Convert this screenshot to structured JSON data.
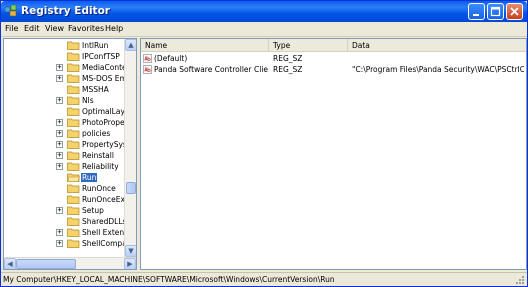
{
  "window": {
    "title": "Registry Editor"
  },
  "menu": [
    "File",
    "Edit",
    "View",
    "Favorites",
    "Help"
  ],
  "tree": {
    "items": [
      {
        "label": "IntlRun",
        "expandable": false,
        "selected": false
      },
      {
        "label": "IPConfTSP",
        "expandable": false,
        "selected": false
      },
      {
        "label": "MediaContentI",
        "expandable": true,
        "selected": false
      },
      {
        "label": "MS-DOS Emul",
        "expandable": true,
        "selected": false
      },
      {
        "label": "MSSHA",
        "expandable": false,
        "selected": false
      },
      {
        "label": "Nls",
        "expandable": true,
        "selected": false
      },
      {
        "label": "OptimalLayou",
        "expandable": false,
        "selected": false
      },
      {
        "label": "PhotoPropert",
        "expandable": true,
        "selected": false
      },
      {
        "label": "policies",
        "expandable": true,
        "selected": false
      },
      {
        "label": "PropertySyste",
        "expandable": true,
        "selected": false
      },
      {
        "label": "Reinstall",
        "expandable": true,
        "selected": false
      },
      {
        "label": "Reliability",
        "expandable": true,
        "selected": false
      },
      {
        "label": "Run",
        "expandable": false,
        "selected": true
      },
      {
        "label": "RunOnce",
        "expandable": false,
        "selected": false
      },
      {
        "label": "RunOnceEx",
        "expandable": false,
        "selected": false
      },
      {
        "label": "Setup",
        "expandable": true,
        "selected": false
      },
      {
        "label": "SharedDLLs",
        "expandable": false,
        "selected": false
      },
      {
        "label": "Shell Extensic",
        "expandable": true,
        "selected": false
      },
      {
        "label": "ShellCompatib",
        "expandable": true,
        "selected": false
      }
    ]
  },
  "columns": {
    "name": "Name",
    "type": "Type",
    "data": "Data"
  },
  "values": [
    {
      "name": "(Default)",
      "type": "REG_SZ",
      "data": ""
    },
    {
      "name": "Panda Software Controller Client",
      "type": "REG_SZ",
      "data": "\"C:\\Program Files\\Panda Security\\WAC\\PSCtrlC.exe\""
    }
  ],
  "status": {
    "path": "My Computer\\HKEY_LOCAL_MACHINE\\SOFTWARE\\Microsoft\\Windows\\CurrentVersion\\Run"
  },
  "scroll": {
    "tree_vertical_position": 0.72,
    "tree_horizontal_position": 0.0
  },
  "colors": {
    "titlebar": "#0a5cf0",
    "selection": "#316ac5",
    "folder": "#f5d36a"
  },
  "icons": {
    "app": "registry-editor-icon",
    "folder": "folder-icon",
    "value": "string-value-icon",
    "minimize": "minimize-icon",
    "maximize": "maximize-icon",
    "close": "close-icon"
  }
}
